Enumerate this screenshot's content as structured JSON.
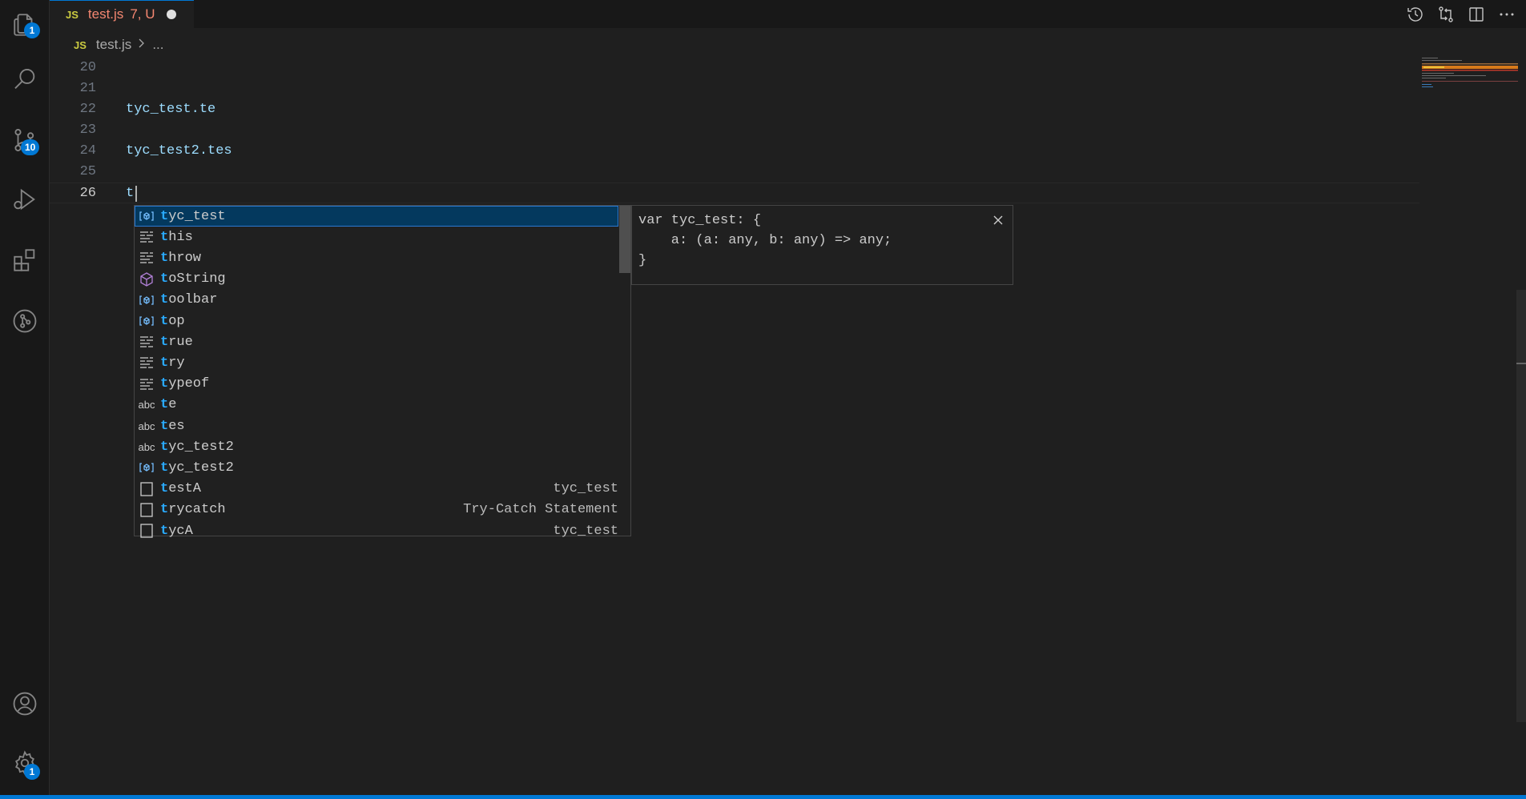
{
  "activity_bar": {
    "explorer_badge": "1",
    "source_control_badge": "10",
    "settings_badge": "1"
  },
  "tab": {
    "file_type": "JS",
    "name": "test.js",
    "status": "7, U"
  },
  "breadcrumb": {
    "file_type": "JS",
    "file": "test.js",
    "more": "..."
  },
  "editor": {
    "lines": [
      {
        "num": "20",
        "code": ""
      },
      {
        "num": "21",
        "code": ""
      },
      {
        "num": "22",
        "code": "tyc_test.te"
      },
      {
        "num": "23",
        "code": ""
      },
      {
        "num": "24",
        "code": "tyc_test2.tes"
      },
      {
        "num": "25",
        "code": ""
      },
      {
        "num": "26",
        "code": "t"
      }
    ]
  },
  "suggestions": [
    {
      "icon": "variable-icon",
      "match": "t",
      "rest": "yc_test",
      "detail": ""
    },
    {
      "icon": "keyword-icon",
      "match": "t",
      "rest": "his",
      "detail": ""
    },
    {
      "icon": "keyword-icon",
      "match": "t",
      "rest": "hrow",
      "detail": ""
    },
    {
      "icon": "method-icon",
      "match": "t",
      "rest": "oString",
      "detail": ""
    },
    {
      "icon": "variable-icon",
      "match": "t",
      "rest": "oolbar",
      "detail": ""
    },
    {
      "icon": "variable-icon",
      "match": "t",
      "rest": "op",
      "detail": ""
    },
    {
      "icon": "keyword-icon",
      "match": "t",
      "rest": "rue",
      "detail": ""
    },
    {
      "icon": "keyword-icon",
      "match": "t",
      "rest": "ry",
      "detail": ""
    },
    {
      "icon": "keyword-icon",
      "match": "t",
      "rest": "ypeof",
      "detail": ""
    },
    {
      "icon": "text-icon",
      "match": "t",
      "rest": "e",
      "detail": ""
    },
    {
      "icon": "text-icon",
      "match": "t",
      "rest": "es",
      "detail": ""
    },
    {
      "icon": "text-icon",
      "match": "t",
      "rest": "yc_test2",
      "detail": ""
    },
    {
      "icon": "variable-icon",
      "match": "t",
      "rest": "yc_test2",
      "detail": ""
    },
    {
      "icon": "snippet-icon",
      "match": "t",
      "rest": "estA",
      "detail": "tyc_test"
    },
    {
      "icon": "snippet-icon",
      "match": "t",
      "rest": "rycatch",
      "detail": "Try-Catch Statement"
    },
    {
      "icon": "snippet-icon",
      "match": "t",
      "rest": "ycA",
      "detail": "tyc_test"
    }
  ],
  "details": {
    "text": "var tyc_test: {\n    a: (a: any, b: any) => any;\n}"
  },
  "text_icon_label": "abc",
  "colors": {
    "accent": "#0078d4",
    "highlight": "#2aaaff",
    "selection": "#04395e",
    "modified": "#f48771"
  }
}
